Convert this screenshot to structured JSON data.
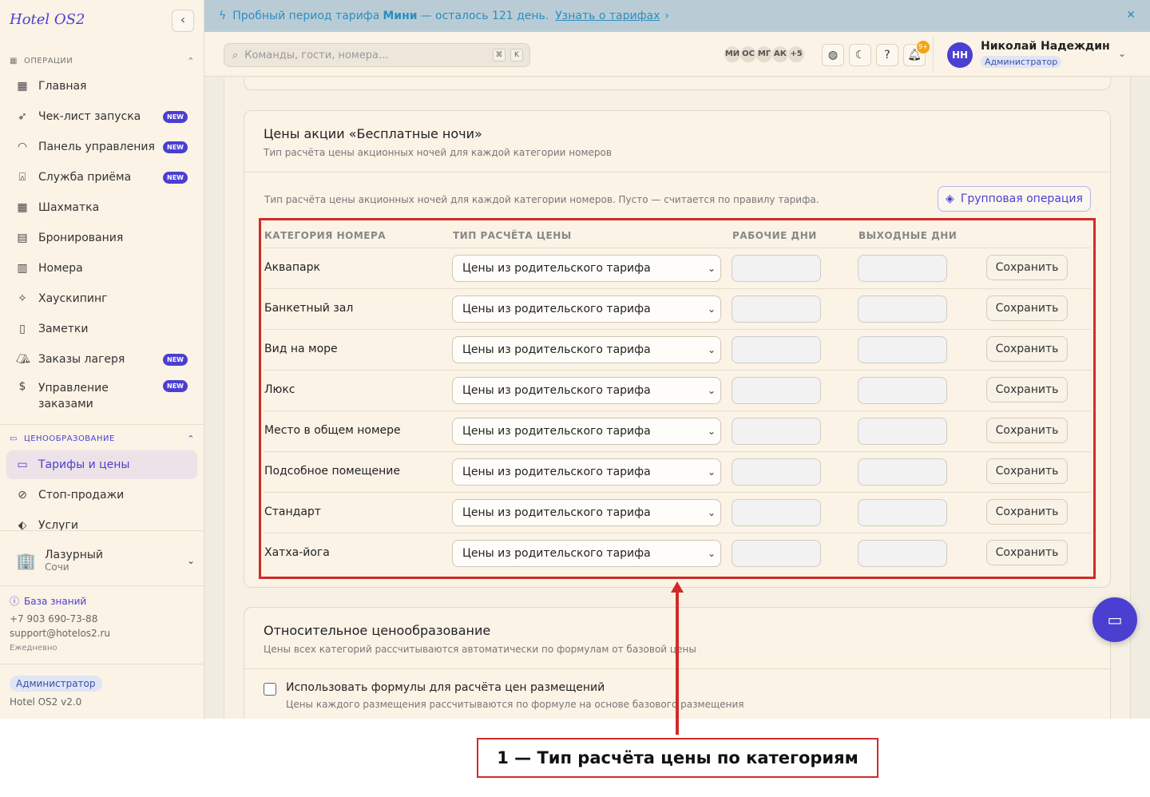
{
  "app": {
    "title": "Hotel OS2"
  },
  "banner": {
    "text_before": "Пробный период тарифа",
    "plan": "Мини",
    "text_after": "— осталось 121 день.",
    "link": "Узнать о тарифах",
    "link_chevron": "›",
    "close": "✕"
  },
  "search": {
    "placeholder": "Команды, гости, номера...",
    "key1": "⌘",
    "key2": "K"
  },
  "presence": {
    "avatars": [
      "МИ",
      "ОС",
      "МГ",
      "АК"
    ],
    "more": "+5"
  },
  "notifications": {
    "badge": "9+"
  },
  "user": {
    "initials": "НН",
    "name": "Николай Надеждин",
    "role": "Администратор"
  },
  "sidebar": {
    "sections": [
      {
        "title": "ОПЕРАЦИИ"
      },
      {
        "title": "ЦЕНООБРАЗОВАНИЕ"
      }
    ],
    "new_badge": "NEW",
    "operations": [
      {
        "label": "Главная",
        "icon": "dashboard-icon"
      },
      {
        "label": "Чек-лист запуска",
        "icon": "rocket-icon",
        "badge": true
      },
      {
        "label": "Панель управления",
        "icon": "gauge-icon",
        "badge": true
      },
      {
        "label": "Служба приёма",
        "icon": "bell-icon",
        "badge": true
      },
      {
        "label": "Шахматка",
        "icon": "grid-icon"
      },
      {
        "label": "Бронирования",
        "icon": "clipboard-icon"
      },
      {
        "label": "Номера",
        "icon": "building-icon"
      },
      {
        "label": "Хаускипинг",
        "icon": "sparkle-icon"
      },
      {
        "label": "Заметки",
        "icon": "note-icon"
      },
      {
        "label": "Заказы лагеря",
        "icon": "tent-icon",
        "badge": true
      },
      {
        "label": "Управление заказами",
        "icon": "receipt-icon",
        "badge": true
      }
    ],
    "pricing": [
      {
        "label": "Тарифы и цены",
        "icon": "card-icon",
        "active": true
      },
      {
        "label": "Стоп-продажи",
        "icon": "ban-icon"
      },
      {
        "label": "Услуги",
        "icon": "tag-icon"
      }
    ],
    "hotel": {
      "name": "Лазурный",
      "city": "Сочи"
    },
    "knowledge_base": "База знаний",
    "phone": "+7 903 690-73-88",
    "email": "support@hotelos2.ru",
    "hours": "Ежедневно",
    "role": "Администратор",
    "version": "Hotel OS2 v2.0"
  },
  "free_nights": {
    "title": "Цены акции «Бесплатные ночи»",
    "subtitle": "Тип расчёта цены акционных ночей для каждой категории номеров",
    "hint": "Тип расчёта цены акционных ночей для каждой категории номеров. Пусто — считается по правилу тарифа.",
    "group_button": "Групповая операция",
    "columns": [
      "КАТЕГОРИЯ НОМЕРА",
      "ТИП РАСЧЁТА ЦЕНЫ",
      "РАБОЧИЕ ДНИ",
      "ВЫХОДНЫЕ ДНИ"
    ],
    "select_value": "Цены из родительского тарифа",
    "save_label": "Сохранить",
    "rows": [
      "Аквапарк",
      "Банкетный зал",
      "Вид на море",
      "Люкс",
      "Место в общем номере",
      "Подсобное помещение",
      "Стандарт",
      "Хатха-йога"
    ]
  },
  "relative_pricing": {
    "title": "Относительное ценообразование",
    "subtitle": "Цены всех категорий рассчитываются автоматически по формулам от базовой цены",
    "checkbox_label": "Использовать формулы для расчёта цен размещений",
    "checkbox_sub": "Цены каждого размещения рассчитываются по формуле на основе базового размещения"
  },
  "annotation": {
    "callout": "1 — Тип расчёта цены по категориям"
  },
  "colors": {
    "accent": "#4b3fd1",
    "annotation": "#d12a2a",
    "banner": "#b9ccd6"
  }
}
